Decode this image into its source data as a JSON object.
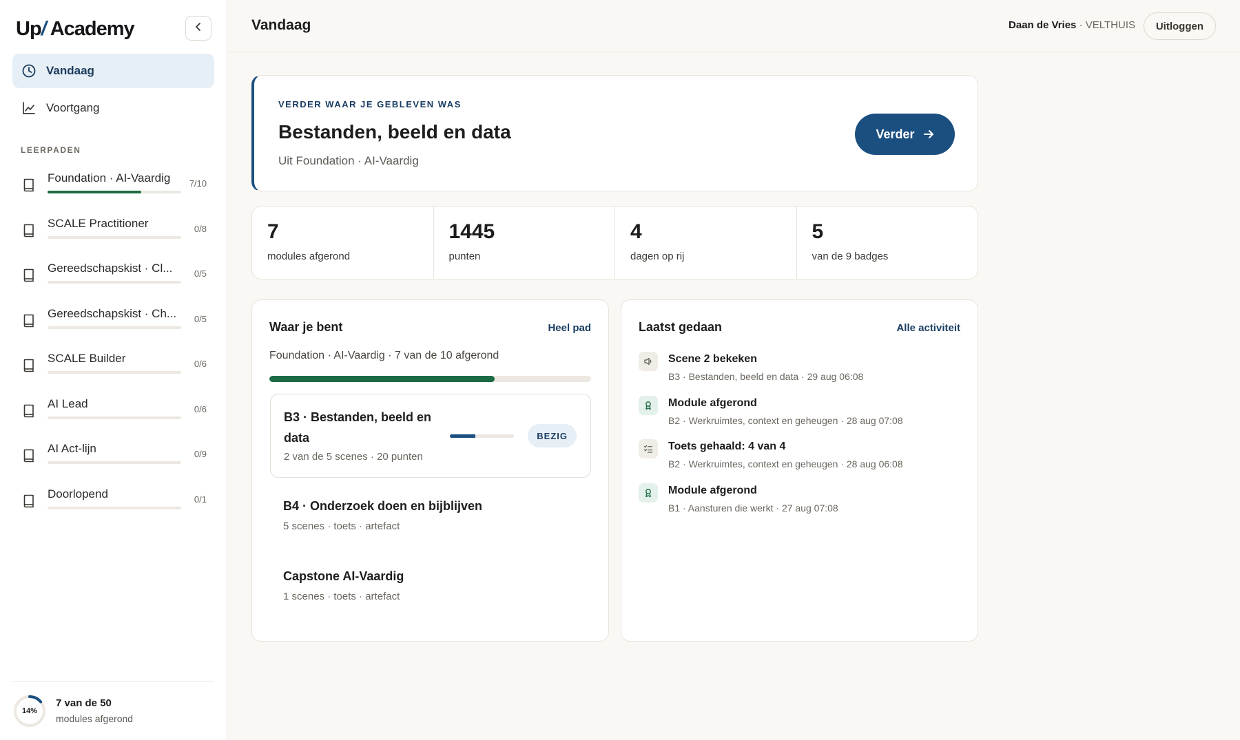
{
  "app": {
    "logo_up": "Up",
    "logo_slash": "/",
    "logo_academy": " Academy"
  },
  "nav": {
    "items": [
      {
        "label": "Vandaag",
        "icon": "clock-icon",
        "active": true
      },
      {
        "label": "Voortgang",
        "icon": "chart-line-icon",
        "active": false
      }
    ]
  },
  "sidebar": {
    "section_label": "LEERPADEN",
    "paths": [
      {
        "name": "Foundation · AI-Vaardig",
        "count": "7/10",
        "progress": 0.7
      },
      {
        "name": "SCALE Practitioner",
        "count": "0/8",
        "progress": 0
      },
      {
        "name": "Gereedschapskist · Cl...",
        "count": "0/5",
        "progress": 0
      },
      {
        "name": "Gereedschapskist · Ch...",
        "count": "0/5",
        "progress": 0
      },
      {
        "name": "SCALE Builder",
        "count": "0/6",
        "progress": 0
      },
      {
        "name": "AI Lead",
        "count": "0/6",
        "progress": 0
      },
      {
        "name": "AI Act-lijn",
        "count": "0/9",
        "progress": 0
      },
      {
        "name": "Doorlopend",
        "count": "0/1",
        "progress": 0
      }
    ],
    "footer": {
      "percent_label": "14%",
      "percent": 0.14,
      "title": "7 van de 50",
      "subtitle": "modules afgerond"
    }
  },
  "header": {
    "title": "Vandaag",
    "user_name": "Daan de Vries",
    "separator": " · ",
    "org": "VELTHUIS",
    "logout_label": "Uitloggen"
  },
  "resume": {
    "kicker": "VERDER WAAR JE GEBLEVEN WAS",
    "title": "Bestanden, beeld en data",
    "subtitle": "Uit Foundation · AI-Vaardig",
    "cta_label": "Verder"
  },
  "stats": [
    {
      "value": "7",
      "label": "modules afgerond"
    },
    {
      "value": "1445",
      "label": "punten"
    },
    {
      "value": "4",
      "label": "dagen op rij"
    },
    {
      "value": "5",
      "label": "van de 9 badges"
    }
  ],
  "where": {
    "title": "Waar je bent",
    "link": "Heel pad",
    "meta": "Foundation · AI-Vaardig · 7 van de 10 afgerond",
    "progress": 0.7,
    "current": {
      "title": "B3 · Bestanden, beeld en data",
      "subtitle": "2 van de 5 scenes · 20 punten",
      "progress": 0.4,
      "badge": "BEZIG"
    },
    "next": [
      {
        "title": "B4 · Onderzoek doen en bijblijven",
        "subtitle": "5 scenes · toets · artefact"
      },
      {
        "title": "Capstone AI-Vaardig",
        "subtitle": "1 scenes · toets · artefact"
      }
    ]
  },
  "activity": {
    "title": "Laatst gedaan",
    "link": "Alle activiteit",
    "items": [
      {
        "icon": "speaker-icon",
        "tone": "gray",
        "title": "Scene 2 bekeken",
        "subtitle": "B3 · Bestanden, beeld en data · 29 aug 06:08"
      },
      {
        "icon": "award-icon",
        "tone": "green",
        "title": "Module afgerond",
        "subtitle": "B2 · Werkruimtes, context en geheugen · 28 aug 07:08"
      },
      {
        "icon": "checklist-icon",
        "tone": "gray",
        "title": "Toets gehaald: 4 van 4",
        "subtitle": "B2 · Werkruimtes, context en geheugen · 28 aug 06:08"
      },
      {
        "icon": "award-icon",
        "tone": "green",
        "title": "Module afgerond",
        "subtitle": "B1 · Aansturen die werkt · 27 aug 07:08"
      }
    ]
  },
  "colors": {
    "accent": "#1b4f80",
    "success": "#1c6b45",
    "background": "#faf8f4"
  }
}
